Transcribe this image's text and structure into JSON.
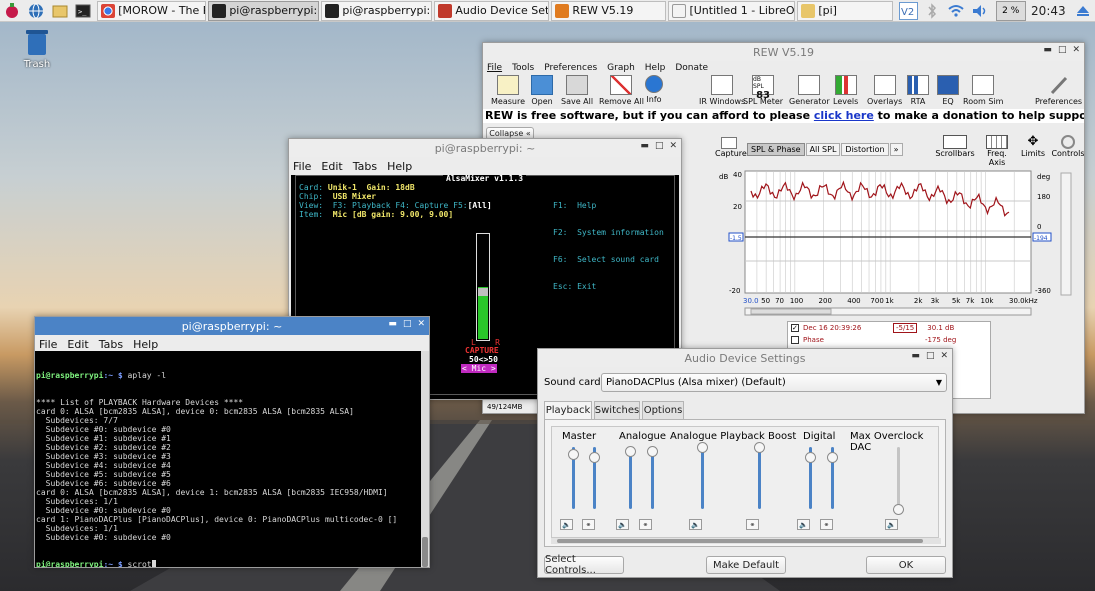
{
  "taskbar": {
    "tasks": [
      {
        "label": "[MOROW - The Prog..."
      },
      {
        "label": "pi@raspberrypi: ~"
      },
      {
        "label": "pi@raspberrypi: ~"
      },
      {
        "label": "Audio Device Settings"
      },
      {
        "label": "REW V5.19"
      },
      {
        "label": "[Untitled 1 - LibreOffi..."
      },
      {
        "label": "[pi]"
      }
    ],
    "cpu_label": "2 %",
    "clock": "20:43"
  },
  "desktop": {
    "trash_label": "Trash"
  },
  "rew": {
    "title": "REW V5.19",
    "menu": [
      "File",
      "Tools",
      "Preferences",
      "Graph",
      "Help",
      "Donate"
    ],
    "toolbar": [
      "Measure",
      "Open",
      "Save All",
      "Remove All",
      "Info",
      "IR Windows",
      "SPL Meter",
      "Generator",
      "Levels",
      "Overlays",
      "RTA",
      "EQ",
      "Room Sim",
      "Preferences"
    ],
    "spl_badge": "dB SPL",
    "spl_value": "83",
    "banner_prefix": "REW is free software, but if you can afford to please ",
    "banner_link": "click here",
    "banner_suffix": " to make a donation to help support its continuin",
    "collapse_label": "Collapse",
    "capture_label": "Capture",
    "graph_tabs": [
      "SPL & Phase",
      "All SPL",
      "Distortion"
    ],
    "graph_tools": [
      "Scrollbars",
      "Freq. Axis",
      "Limits",
      "Controls"
    ],
    "y_left_unit": "dB",
    "y_right_unit": "deg",
    "y_left_ticks": [
      "40",
      "20",
      "-20"
    ],
    "y_right_ticks": [
      "180",
      "0",
      "-360"
    ],
    "marker_left": "-1.5",
    "marker_right": "-194",
    "x_ticks": [
      "30.0",
      "50",
      "70",
      "100",
      "200",
      "400",
      "700",
      "1k",
      "2k",
      "3k",
      "5k",
      "7k",
      "10k",
      "30.0kHz"
    ],
    "legend": [
      {
        "date": "Dec 16 20:39:26",
        "value_box": "-5/15",
        "value": "30.1 dB"
      },
      {
        "date": "Phase",
        "value": "-175 deg"
      }
    ],
    "legend_faint": [
      "deg",
      "deg",
      "dB",
      "dB"
    ],
    "memory": "49/124MB"
  },
  "alsamixer_window": {
    "title": "pi@raspberrypi: ~",
    "menu": [
      "File",
      "Edit",
      "Tabs",
      "Help"
    ],
    "header": "AlsaMixer v1.1.3",
    "card_label": "Card:",
    "card_value": "Unik-1",
    "gain_label": "Gain: 18dB",
    "chip_label": "Chip:",
    "chip_value": "USB Mixer",
    "view_label": "View:",
    "view_value": "F3: Playback F4: Capture F5:",
    "view_selected": "[All]",
    "item_label": "Item:",
    "item_value": "Mic [dB gain: 9.00, 9.00]",
    "help_lines": [
      "F1:  Help",
      "F2:  System information",
      "F6:  Select sound card",
      "Esc: Exit"
    ],
    "lr_label": "L    R",
    "capture_label": "CAPTURE",
    "level_label": "50<>50",
    "control_label": "< Mic >",
    "level_fraction": 0.5
  },
  "terminal": {
    "title": "pi@raspberrypi: ~",
    "menu": [
      "File",
      "Edit",
      "Tabs",
      "Help"
    ],
    "prompt_user": "pi@raspberrypi",
    "prompt_path": ":~ $ ",
    "command1": "aplay -l",
    "lines": [
      "**** List of PLAYBACK Hardware Devices ****",
      "card 0: ALSA [bcm2835 ALSA], device 0: bcm2835 ALSA [bcm2835 ALSA]",
      "  Subdevices: 7/7",
      "  Subdevice #0: subdevice #0",
      "  Subdevice #1: subdevice #1",
      "  Subdevice #2: subdevice #2",
      "  Subdevice #3: subdevice #3",
      "  Subdevice #4: subdevice #4",
      "  Subdevice #5: subdevice #5",
      "  Subdevice #6: subdevice #6",
      "card 0: ALSA [bcm2835 ALSA], device 1: bcm2835 ALSA [bcm2835 IEC958/HDMI]",
      "  Subdevices: 1/1",
      "  Subdevice #0: subdevice #0",
      "card 1: PianoDACPlus [PianoDACPlus], device 0: PianoDACPlus multicodec-0 []",
      "  Subdevices: 1/1",
      "  Subdevice #0: subdevice #0"
    ],
    "command2": "scrot"
  },
  "audio": {
    "title": "Audio Device Settings",
    "sound_card_label": "Sound card:",
    "sound_card_value": "PianoDACPlus (Alsa mixer) (Default)",
    "tabs": [
      "Playback",
      "Switches",
      "Options"
    ],
    "channels": [
      {
        "name": "Master",
        "levels": [
          0.88,
          0.84
        ]
      },
      {
        "name": "Analogue",
        "levels": [
          0.93,
          0.93
        ]
      },
      {
        "name": "Analogue Playback Boost",
        "levels": [
          1.0,
          1.0
        ]
      },
      {
        "name": "Digital",
        "levels": [
          0.84,
          0.84
        ]
      },
      {
        "name": "Max Overclock DAC",
        "levels": [
          0.0
        ]
      }
    ],
    "buttons": {
      "select": "Select Controls...",
      "default": "Make Default",
      "ok": "OK"
    }
  }
}
